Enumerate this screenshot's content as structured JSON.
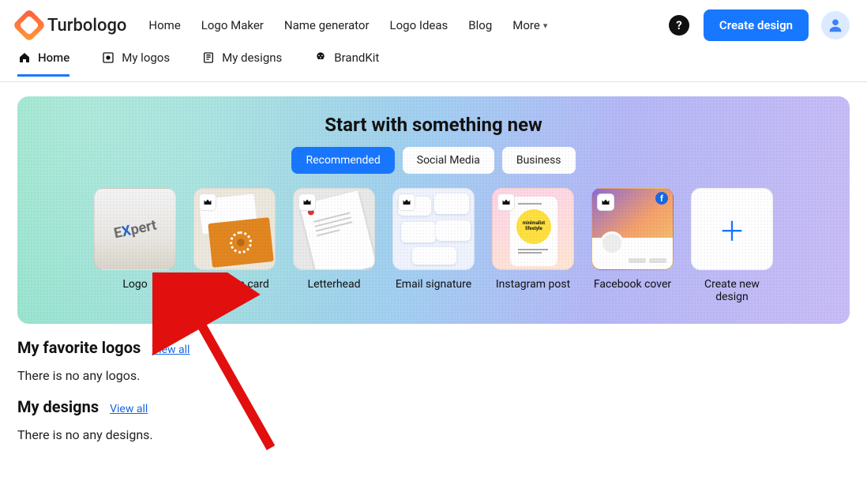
{
  "brand": {
    "name": "Turbologo"
  },
  "nav": {
    "items": [
      "Home",
      "Logo Maker",
      "Name generator",
      "Logo Ideas",
      "Blog",
      "More"
    ]
  },
  "actions": {
    "help": "?",
    "cta": "Create design"
  },
  "subtabs": {
    "items": [
      {
        "label": "Home",
        "icon": "home-icon",
        "active": true
      },
      {
        "label": "My logos",
        "icon": "logos-icon",
        "active": false
      },
      {
        "label": "My designs",
        "icon": "designs-icon",
        "active": false
      },
      {
        "label": "BrandKit",
        "icon": "brandkit-icon",
        "active": false
      }
    ]
  },
  "hero": {
    "title": "Start with something new",
    "filters": [
      {
        "label": "Recommended",
        "active": true
      },
      {
        "label": "Social Media",
        "active": false
      },
      {
        "label": "Business",
        "active": false
      }
    ],
    "cards": [
      {
        "label": "Logo",
        "premium": false,
        "kind": "logo"
      },
      {
        "label": "Business card",
        "premium": true,
        "kind": "bc"
      },
      {
        "label": "Letterhead",
        "premium": true,
        "kind": "lh"
      },
      {
        "label": "Email signature",
        "premium": true,
        "kind": "es"
      },
      {
        "label": "Instagram post",
        "premium": true,
        "kind": "ig"
      },
      {
        "label": "Facebook cover",
        "premium": true,
        "kind": "fb"
      },
      {
        "label": "Create new design",
        "premium": false,
        "kind": "new"
      }
    ]
  },
  "sections": {
    "favorites": {
      "title": "My favorite logos",
      "view_all": "View all",
      "empty": "There is no any logos."
    },
    "designs": {
      "title": "My designs",
      "view_all": "View all",
      "empty": "There is no any designs."
    }
  }
}
